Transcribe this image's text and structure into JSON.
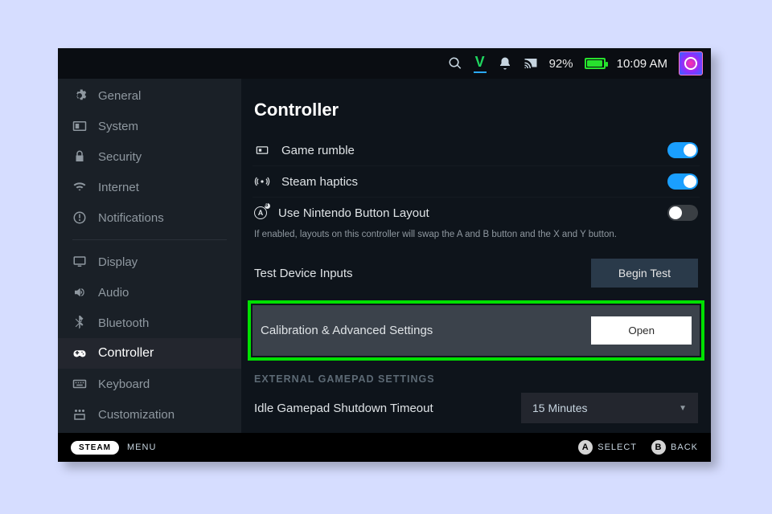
{
  "statusbar": {
    "battery_pct": "92%",
    "time": "10:09 AM"
  },
  "sidebar": {
    "items": [
      {
        "label": "General"
      },
      {
        "label": "System"
      },
      {
        "label": "Security"
      },
      {
        "label": "Internet"
      },
      {
        "label": "Notifications"
      },
      {
        "label": "Display"
      },
      {
        "label": "Audio"
      },
      {
        "label": "Bluetooth"
      },
      {
        "label": "Controller"
      },
      {
        "label": "Keyboard"
      },
      {
        "label": "Customization"
      }
    ]
  },
  "page": {
    "title": "Controller",
    "game_rumble": "Game rumble",
    "steam_haptics": "Steam haptics",
    "nintendo_layout": "Use Nintendo Button Layout",
    "nintendo_help": "If enabled, layouts on this controller will swap the A and B button and the X and Y button.",
    "test_inputs": "Test Device Inputs",
    "begin_test": "Begin Test",
    "calibration": "Calibration & Advanced Settings",
    "open": "Open",
    "external_section": "EXTERNAL GAMEPAD SETTINGS",
    "idle_timeout": "Idle Gamepad Shutdown Timeout",
    "idle_value": "15 Minutes"
  },
  "toggles": {
    "game_rumble": true,
    "steam_haptics": true,
    "nintendo_layout": false
  },
  "footer": {
    "steam": "STEAM",
    "menu": "MENU",
    "a": "A",
    "select": "SELECT",
    "b": "B",
    "back": "BACK"
  }
}
